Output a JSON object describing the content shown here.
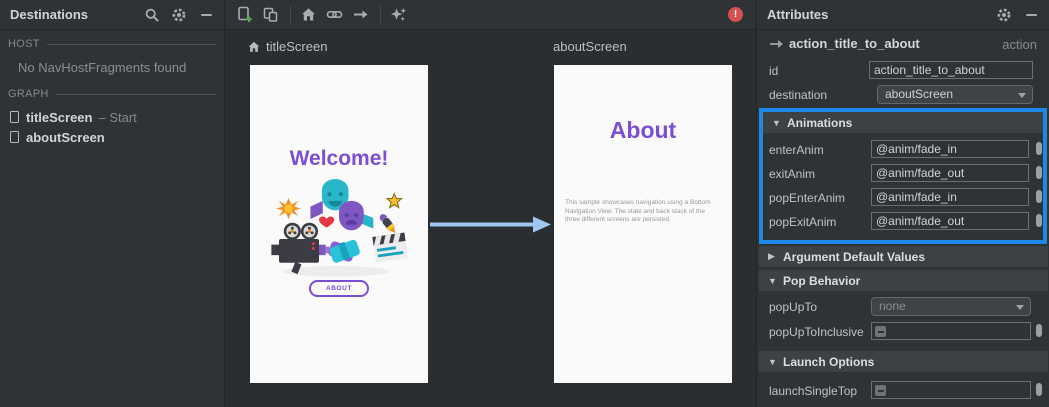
{
  "colors": {
    "accent_purple": "#7b4ed2",
    "selection_blue": "#1e88e5",
    "action_arrow_blue": "#9ec7f0",
    "error_red": "#d45151"
  },
  "destinations_panel": {
    "title": "Destinations",
    "icons": [
      "search-icon",
      "gear-icon",
      "minimize-icon"
    ],
    "host": {
      "label": "HOST",
      "empty_message": "No NavHostFragments found"
    },
    "graph": {
      "label": "GRAPH",
      "items": [
        {
          "name": "titleScreen",
          "suffix": "– Start"
        },
        {
          "name": "aboutScreen",
          "suffix": ""
        }
      ]
    }
  },
  "canvas": {
    "toolbar_icons": [
      "new-destination-icon",
      "nested-graph-icon",
      "assign-start-icon",
      "deep-link-icon",
      "action-icon",
      "auto-arrange-icon"
    ],
    "error_badge": "!",
    "screens": [
      {
        "label": "titleScreen",
        "heading": "Welcome!",
        "button": "ABOUT"
      },
      {
        "label": "aboutScreen",
        "heading": "About",
        "body": "This sample showcases navigation using a Bottom Navigation View. The state and back stack of the three different screens are persisted."
      }
    ]
  },
  "attributes_panel": {
    "title": "Attributes",
    "icons": [
      "gear-icon",
      "minimize-icon"
    ],
    "action_header": {
      "name": "action_title_to_about",
      "type": "action"
    },
    "id_row": {
      "label": "id",
      "value": "action_title_to_about"
    },
    "destination_row": {
      "label": "destination",
      "value": "aboutScreen"
    },
    "animations": {
      "glyph": "▼",
      "title": "Animations",
      "rows": [
        {
          "label": "enterAnim",
          "value": "@anim/fade_in"
        },
        {
          "label": "exitAnim",
          "value": "@anim/fade_out"
        },
        {
          "label": "popEnterAnim",
          "value": "@anim/fade_in"
        },
        {
          "label": "popExitAnim",
          "value": "@anim/fade_out"
        }
      ]
    },
    "argument_defaults": {
      "glyph": "▶",
      "title": "Argument Default Values"
    },
    "pop_behavior": {
      "glyph": "▼",
      "title": "Pop Behavior",
      "pop_up_to": {
        "label": "popUpTo",
        "value": "none"
      },
      "pop_up_to_inclusive": {
        "label": "popUpToInclusive"
      }
    },
    "launch_options": {
      "glyph": "▼",
      "title": "Launch Options",
      "launch_single_top": {
        "label": "launchSingleTop"
      }
    }
  }
}
